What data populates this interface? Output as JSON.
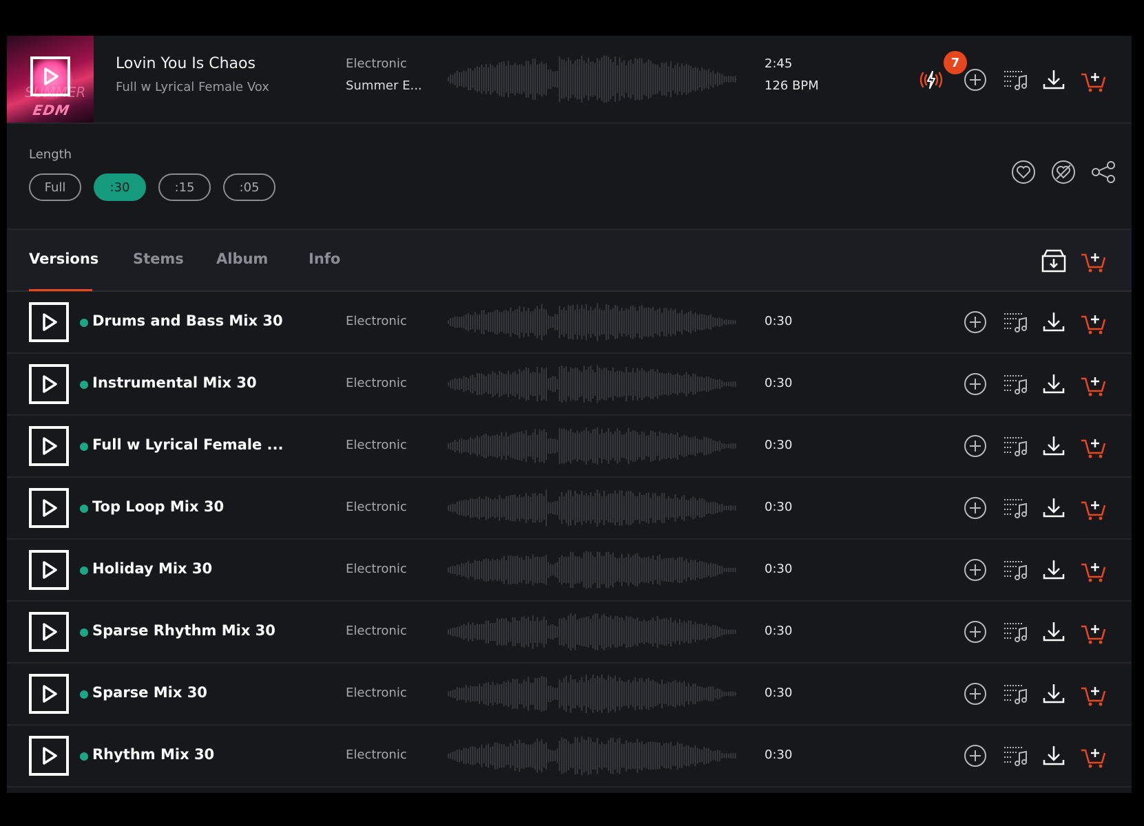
{
  "track": {
    "title": "Lovin You Is Chaos",
    "subtitle": "Full w Lyrical Female Vox",
    "genre": "Electronic",
    "album": "Summer E...",
    "duration": "2:45",
    "bpm": "126 BPM",
    "cover_text": "EDM",
    "cover_word": "SUMMER",
    "badge_count": "7"
  },
  "length": {
    "label": "Length",
    "options": [
      "Full",
      ":30",
      ":15",
      ":05"
    ],
    "selected": ":30"
  },
  "tabs": [
    {
      "label": "Versions",
      "active": true
    },
    {
      "label": "Stems",
      "active": false
    },
    {
      "label": "Album",
      "active": false
    },
    {
      "label": "Info",
      "active": false
    }
  ],
  "versions": [
    {
      "name": "Drums and Bass Mix 30",
      "genre": "Electronic",
      "duration": "0:30"
    },
    {
      "name": "Instrumental Mix 30",
      "genre": "Electronic",
      "duration": "0:30"
    },
    {
      "name": "Full w Lyrical Female ...",
      "genre": "Electronic",
      "duration": "0:30"
    },
    {
      "name": "Top Loop Mix 30",
      "genre": "Electronic",
      "duration": "0:30"
    },
    {
      "name": "Holiday Mix 30",
      "genre": "Electronic",
      "duration": "0:30"
    },
    {
      "name": "Sparse Rhythm Mix 30",
      "genre": "Electronic",
      "duration": "0:30"
    },
    {
      "name": "Sparse Mix 30",
      "genre": "Electronic",
      "duration": "0:30"
    },
    {
      "name": "Rhythm Mix 30",
      "genre": "Electronic",
      "duration": "0:30"
    }
  ],
  "colors": {
    "accent": "#149a7d",
    "orange": "#e8461c",
    "background": "#17181c"
  },
  "icons": [
    "play-icon",
    "lightning-icon",
    "add-icon",
    "playlist-icon",
    "download-icon",
    "cart-icon",
    "heart-icon",
    "similar-icon",
    "share-icon",
    "download-all-icon"
  ]
}
